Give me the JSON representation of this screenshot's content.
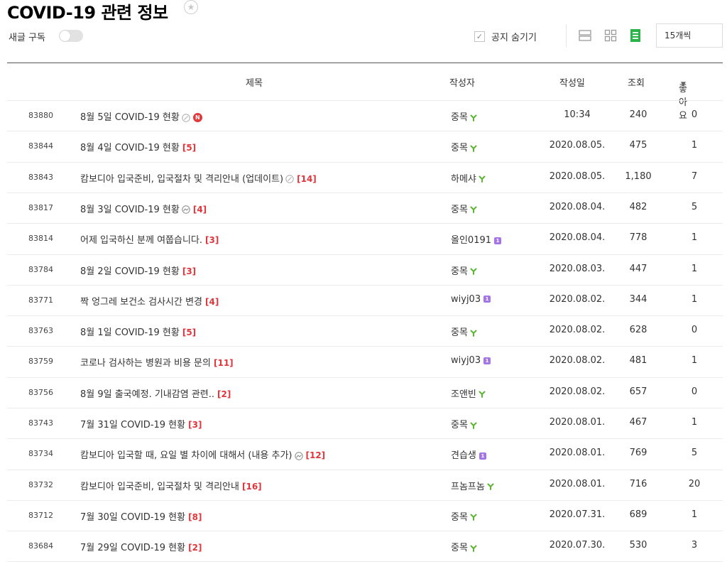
{
  "header": {
    "title": "COVID-19 관련 정보",
    "subscribe_label": "새글 구독",
    "hide_notice_label": "공지 숨기기",
    "per_page_value": "15개씩"
  },
  "table": {
    "columns": {
      "title": "제목",
      "author": "작성자",
      "date": "작성일",
      "views": "조회",
      "likes": "좋아요"
    },
    "rows": [
      {
        "num": "83880",
        "title": "8월 5일 COVID-19 현황",
        "comments": "",
        "icon": "link-icon",
        "new": "N",
        "author": "중목",
        "badge": "sprout",
        "date": "10:34",
        "views": "240",
        "likes": "0"
      },
      {
        "num": "83844",
        "title": "8월 4일 COVID-19 현황",
        "comments": "[5]",
        "icon": "",
        "new": "",
        "author": "중목",
        "badge": "sprout",
        "date": "2020.08.05.",
        "views": "475",
        "likes": "1"
      },
      {
        "num": "83843",
        "title": "캄보디아 입국준비, 입국절차 및 격리안내 (업데이트)",
        "comments": "[14]",
        "icon": "link-icon",
        "new": "",
        "author": "하메샤",
        "badge": "sprout",
        "date": "2020.08.05.",
        "views": "1,180",
        "likes": "7"
      },
      {
        "num": "83817",
        "title": "8월 3일 COVID-19 현황",
        "comments": "[4]",
        "icon": "photo-icon",
        "new": "",
        "author": "중목",
        "badge": "sprout",
        "date": "2020.08.04.",
        "views": "482",
        "likes": "5"
      },
      {
        "num": "83814",
        "title": "어제 입국하신 분께 여쭙습니다.",
        "comments": "[3]",
        "icon": "",
        "new": "",
        "author": "올인0191",
        "badge": "level",
        "date": "2020.08.04.",
        "views": "778",
        "likes": "1"
      },
      {
        "num": "83784",
        "title": "8월 2일 COVID-19 현황",
        "comments": "[3]",
        "icon": "",
        "new": "",
        "author": "중목",
        "badge": "sprout",
        "date": "2020.08.03.",
        "views": "447",
        "likes": "1"
      },
      {
        "num": "83771",
        "title": "짝 엉그레 보건소 검사시간 변경",
        "comments": "[4]",
        "icon": "",
        "new": "",
        "author": "wiyj03",
        "badge": "level",
        "date": "2020.08.02.",
        "views": "344",
        "likes": "1"
      },
      {
        "num": "83763",
        "title": "8월 1일 COVID-19 현황",
        "comments": "[5]",
        "icon": "",
        "new": "",
        "author": "중목",
        "badge": "sprout",
        "date": "2020.08.02.",
        "views": "628",
        "likes": "0"
      },
      {
        "num": "83759",
        "title": "코로나 검사하는 병원과 비용 문의",
        "comments": "[11]",
        "icon": "",
        "new": "",
        "author": "wiyj03",
        "badge": "level",
        "date": "2020.08.02.",
        "views": "481",
        "likes": "1"
      },
      {
        "num": "83756",
        "title": "8월 9일 출국예정. 기내감염 관련..",
        "comments": "[2]",
        "icon": "",
        "new": "",
        "author": "조앤빈",
        "badge": "sprout",
        "date": "2020.08.02.",
        "views": "657",
        "likes": "0"
      },
      {
        "num": "83743",
        "title": "7월 31일 COVID-19 현황",
        "comments": "[3]",
        "icon": "",
        "new": "",
        "author": "중목",
        "badge": "sprout",
        "date": "2020.08.01.",
        "views": "467",
        "likes": "1"
      },
      {
        "num": "83734",
        "title": "캄보디아 입국할 때, 요일 별 차이에 대해서 (내용 추가)",
        "comments": "[12]",
        "icon": "photo-icon",
        "new": "",
        "author": "견습생",
        "badge": "level",
        "date": "2020.08.01.",
        "views": "769",
        "likes": "5"
      },
      {
        "num": "83732",
        "title": "캄보디아 입국준비, 입국절차 및 격리안내",
        "comments": "[16]",
        "icon": "",
        "new": "",
        "author": "프놈프놈",
        "badge": "sprout",
        "date": "2020.08.01.",
        "views": "716",
        "likes": "20"
      },
      {
        "num": "83712",
        "title": "7월 30일 COVID-19 현황",
        "comments": "[8]",
        "icon": "",
        "new": "",
        "author": "중목",
        "badge": "sprout",
        "date": "2020.07.31.",
        "views": "689",
        "likes": "1"
      },
      {
        "num": "83684",
        "title": "7월 29일 COVID-19 현황",
        "comments": "[2]",
        "icon": "",
        "new": "",
        "author": "중목",
        "badge": "sprout",
        "date": "2020.07.30.",
        "views": "530",
        "likes": "3"
      }
    ]
  },
  "colors": {
    "comment_count": "#e0353b",
    "new_badge": "#e2393b",
    "sprout_badge": "#5cb531",
    "level_badge": "#a575e6",
    "active_view": "#2bb34a"
  },
  "icons": {
    "favorite": "star-icon",
    "list_view": "list-view-icon",
    "card_view": "card-view-icon",
    "album_view": "album-view-icon",
    "sort": "sort-desc-icon"
  }
}
